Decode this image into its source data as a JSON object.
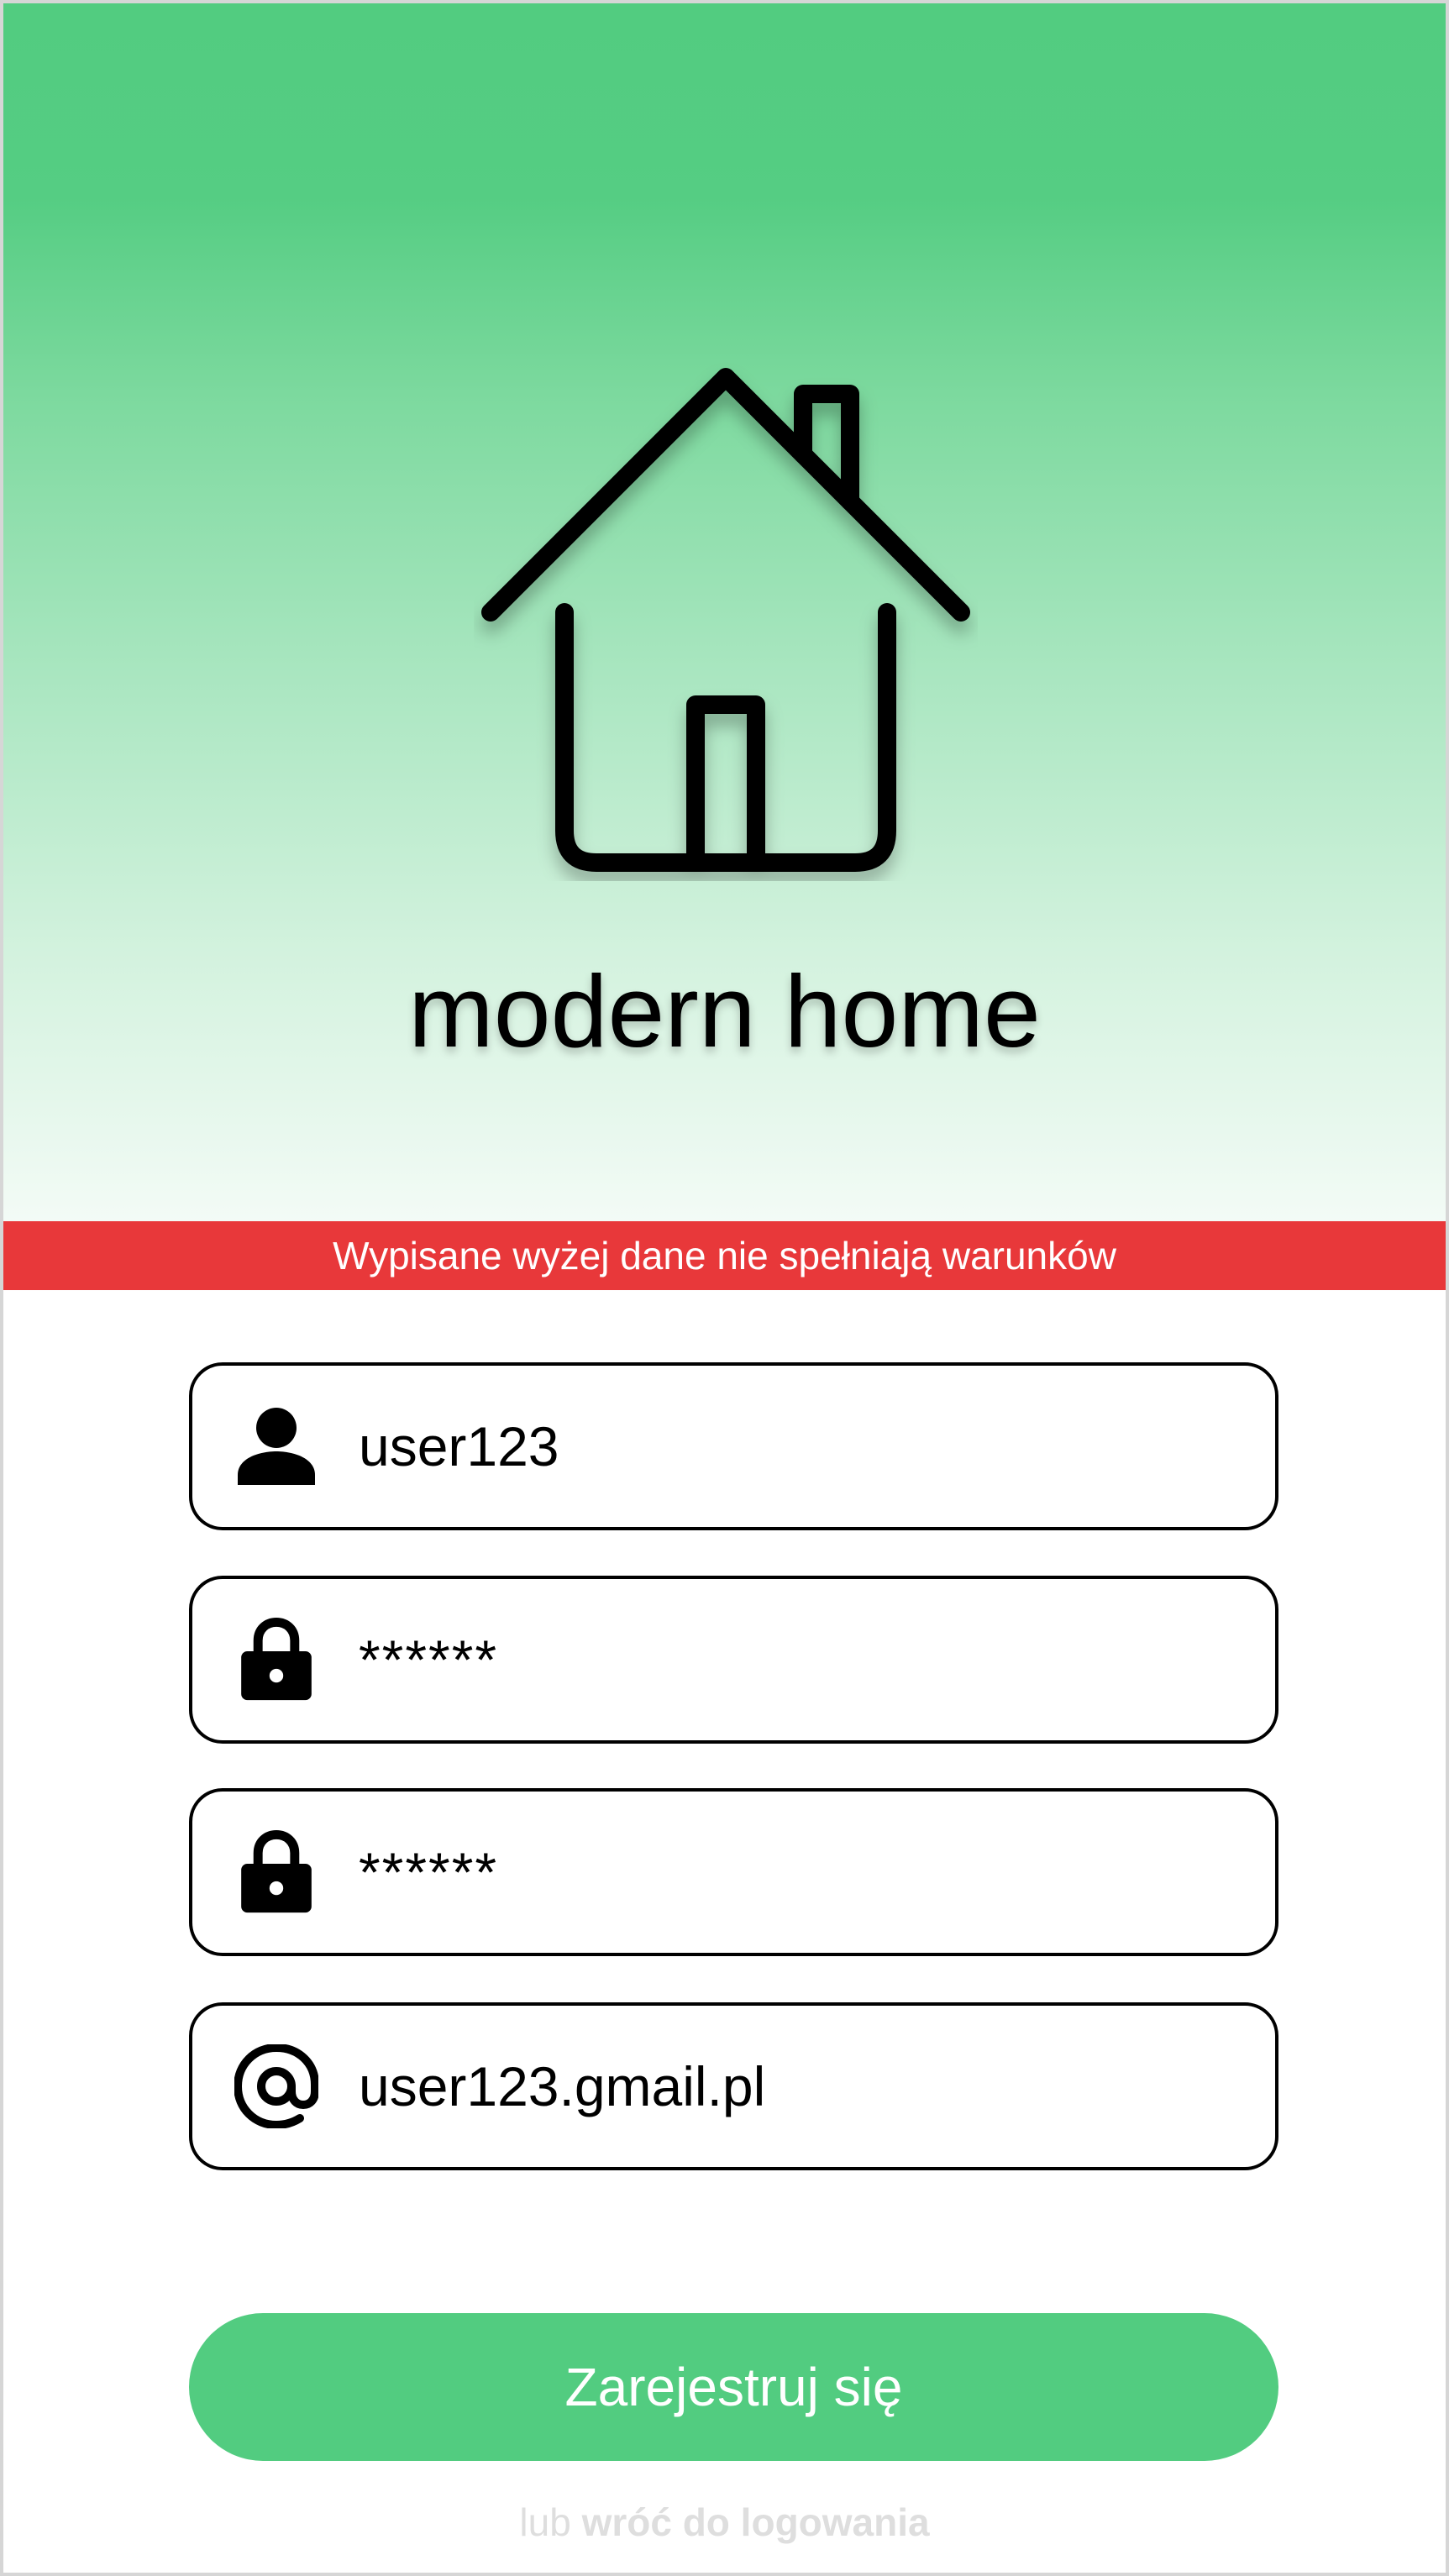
{
  "app": {
    "title": "modern home"
  },
  "error": {
    "message": "Wypisane wyżej dane nie spełniają warunków"
  },
  "form": {
    "username": {
      "icon": "person-icon",
      "value": "user123"
    },
    "password": {
      "icon": "lock-icon",
      "value": "******"
    },
    "password_confirm": {
      "icon": "lock-icon",
      "value": "******"
    },
    "email": {
      "icon": "at-sign-icon",
      "value": "user123.gmail.pl"
    }
  },
  "actions": {
    "register_label": "Zarejestruj się",
    "back_prefix": "lub",
    "back_link_label": "wróć do logowania"
  },
  "colors": {
    "brand_green": "#52cc80",
    "error_red": "#e8383a",
    "muted_link": "#dedede"
  }
}
